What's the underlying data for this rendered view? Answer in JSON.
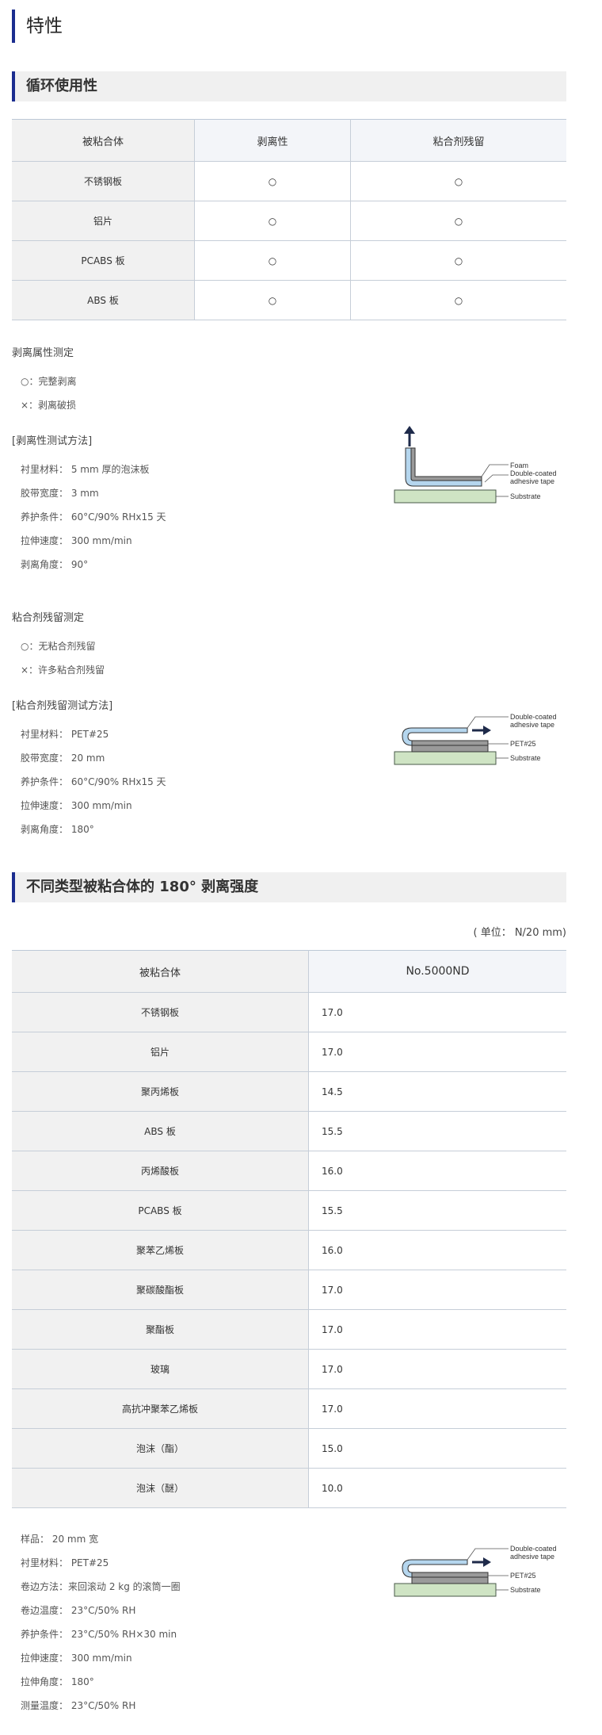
{
  "page_title": "特性",
  "section1": {
    "title": "循环使用性",
    "table": {
      "headers": [
        "被粘合体",
        "剥离性",
        "粘合剂残留"
      ],
      "rows": [
        [
          "不锈钢板",
          "○",
          "○"
        ],
        [
          "铝片",
          "○",
          "○"
        ],
        [
          "PCABS 板",
          "○",
          "○"
        ],
        [
          "ABS 板",
          "○",
          "○"
        ]
      ]
    },
    "peel": {
      "title": "剥离属性测定",
      "legend": [
        "○：完整剥离",
        "×：剥离破损"
      ],
      "method_title": "[剥离性测试方法]",
      "method": [
        "衬里材料： 5 mm 厚的泡沫板",
        "胶带宽度： 3 mm",
        "养护条件： 60°C/90% RHx15 天",
        "拉伸速度： 300 mm/min",
        "剥离角度： 90°"
      ],
      "diagram_labels": [
        "Foam",
        "Double-coated",
        "adhesive tape",
        "Substrate"
      ]
    },
    "residue": {
      "title": "粘合剂残留测定",
      "legend": [
        "○：无粘合剂残留",
        "×：许多粘合剂残留"
      ],
      "method_title": "[粘合剂残留测试方法]",
      "method": [
        "衬里材料： PET#25",
        "胶带宽度： 20 mm",
        "养护条件： 60°C/90% RHx15 天",
        "拉伸速度： 300 mm/min",
        "剥离角度： 180°"
      ],
      "diagram_labels": [
        "Double-coated",
        "adhesive tape",
        "PET#25",
        "Substrate"
      ]
    }
  },
  "section2": {
    "title": "不同类型被粘合体的 180° 剥离强度",
    "unit": "( 单位： N/20 mm)",
    "table": {
      "headers": [
        "被粘合体",
        "No.5000ND"
      ],
      "rows": [
        [
          "不锈钢板",
          "17.0"
        ],
        [
          "铝片",
          "17.0"
        ],
        [
          "聚丙烯板",
          "14.5"
        ],
        [
          "ABS 板",
          "15.5"
        ],
        [
          "丙烯酸板",
          "16.0"
        ],
        [
          "PCABS 板",
          "15.5"
        ],
        [
          "聚苯乙烯板",
          "16.0"
        ],
        [
          "聚碳酸酯板",
          "17.0"
        ],
        [
          "聚酯板",
          "17.0"
        ],
        [
          "玻璃",
          "17.0"
        ],
        [
          "高抗冲聚苯乙烯板",
          "17.0"
        ],
        [
          "泡沫（酯）",
          "15.0"
        ],
        [
          "泡沫（醚）",
          "10.0"
        ]
      ]
    },
    "conditions": [
      "样品： 20 mm 宽",
      "衬里材料： PET#25",
      "卷边方法：来回滚动 2 kg 的滚筒一圈",
      "卷边温度： 23°C/50% RH",
      "养护条件： 23°C/50% RH×30 min",
      "拉伸速度： 300 mm/min",
      "拉伸角度： 180°",
      "测量温度： 23°C/50% RH"
    ],
    "diagram_labels": [
      "Double-coated",
      "adhesive tape",
      "PET#25",
      "Substrate"
    ]
  },
  "colors": {
    "accent": "#1b2d8f",
    "substrate": "#cfe4c4",
    "pet": "#b5d6ee",
    "arrow": "#1e2a4a"
  }
}
